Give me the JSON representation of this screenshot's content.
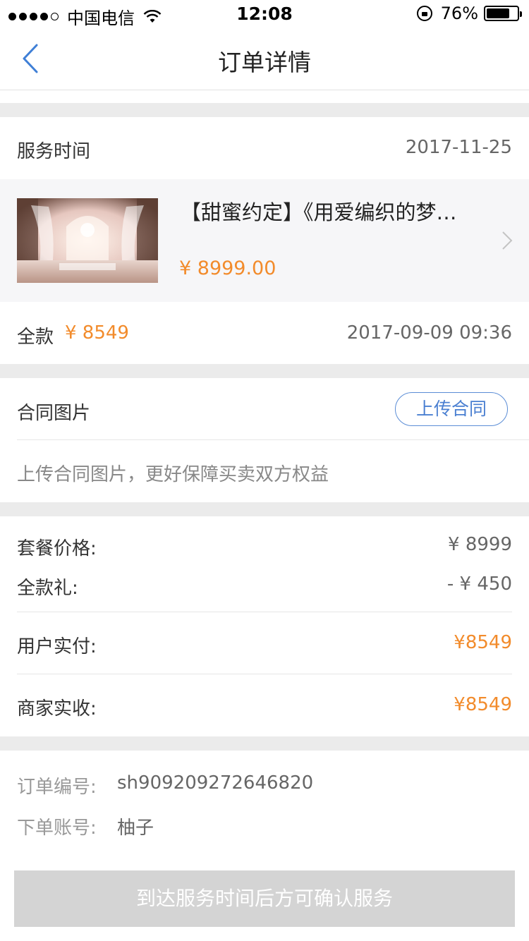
{
  "status_bar": {
    "carrier": "中国电信",
    "time": "12:08",
    "battery_percent": "76%",
    "battery_level": 0.76,
    "signal_bars": 4,
    "icons": [
      "signal-icon",
      "wifi-icon",
      "rotation-lock-icon",
      "battery-icon"
    ]
  },
  "nav": {
    "title": "订单详情",
    "back_icon": "chevron-left-icon"
  },
  "service": {
    "label": "服务时间",
    "date": "2017-11-25"
  },
  "product": {
    "title": "【甜蜜约定】《用爱编织的梦…",
    "price": "¥ 8999.00",
    "image": "wedding-stage-photo",
    "chevron_icon": "chevron-right-icon"
  },
  "payment": {
    "label": "全款",
    "amount": "¥ 8549",
    "datetime": "2017-09-09 09:36"
  },
  "contract": {
    "label": "合同图片",
    "upload_button": "上传合同",
    "hint": "上传合同图片，更好保障买卖双方权益"
  },
  "pricing": {
    "package_label": "套餐价格:",
    "package_value": "¥ 8999",
    "discount_label": "全款礼:",
    "discount_value": "- ¥ 450",
    "user_paid_label": "用户实付:",
    "user_paid_value": "¥8549",
    "merchant_received_label": "商家实收:",
    "merchant_received_value": "¥8549"
  },
  "order_info": {
    "order_no_label": "订单编号:",
    "order_no": "sh909209272646820",
    "account_label": "下单账号:",
    "account": "柚子"
  },
  "action": {
    "confirm_label": "到达服务时间后方可确认服务"
  },
  "colors": {
    "accent_orange": "#f28b2b",
    "link_blue": "#4a7fd1",
    "separator_gray": "#ebebeb",
    "disabled_button": "#d4d4d4"
  }
}
